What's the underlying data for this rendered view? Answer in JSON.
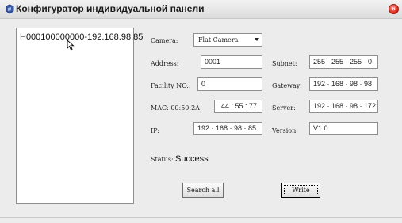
{
  "window": {
    "title": "Конфигуратор индивидуальной панели",
    "close_symbol": "×",
    "icon": "app-icon"
  },
  "device_list": {
    "items": [
      "H000100000000-192.168.98.85"
    ]
  },
  "form": {
    "camera_label": "Camera:",
    "camera_value": "Flat Camera",
    "address_label": "Address:",
    "address_value": "0001",
    "facility_label": "Facility NO.:",
    "facility_value": "0",
    "mac_label": "MAC: 00:50:2A",
    "mac_value": "44 : 55 : 77",
    "ip_label": "IP:",
    "ip_value": "192 · 168 ·  98 ·  85",
    "subnet_label": "Subnet:",
    "subnet_value": "255 · 255 · 255 · 0",
    "gateway_label": "Gateway:",
    "gateway_value": "192 · 168 ·  98 ·  98",
    "server_label": "Server:",
    "server_value": "192 · 168 ·  98 · 172",
    "version_label": "Version:",
    "version_value": "V1.0"
  },
  "status": {
    "label": "Status:",
    "value": "Success"
  },
  "buttons": {
    "search_all": "Search all",
    "write": "Write"
  },
  "colors": {
    "close_button": "#e2301f",
    "window_bg": "#ececec"
  }
}
